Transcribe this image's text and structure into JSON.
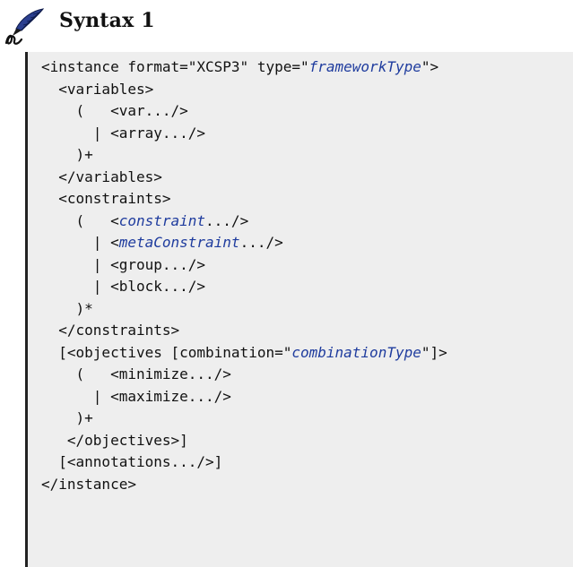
{
  "header": {
    "title": "Syntax 1"
  },
  "code": {
    "lines": [
      [
        {
          "t": "<instance format=\"XCSP3\" type=\""
        },
        {
          "t": "frameworkType",
          "s": "kw"
        },
        {
          "t": "\">"
        }
      ],
      [
        {
          "t": "  <variables>"
        }
      ],
      [
        {
          "t": "    (   <var.../>"
        }
      ],
      [
        {
          "t": "      | <array.../>"
        }
      ],
      [
        {
          "t": "    )+"
        }
      ],
      [
        {
          "t": "  </variables>"
        }
      ],
      [
        {
          "t": "  <constraints>"
        }
      ],
      [
        {
          "t": "    (   <"
        },
        {
          "t": "constraint",
          "s": "kw"
        },
        {
          "t": ".../>"
        }
      ],
      [
        {
          "t": "      | <"
        },
        {
          "t": "metaConstraint",
          "s": "kw"
        },
        {
          "t": ".../>"
        }
      ],
      [
        {
          "t": "      | <group.../>"
        }
      ],
      [
        {
          "t": "      | <block.../>"
        }
      ],
      [
        {
          "t": "    )*"
        }
      ],
      [
        {
          "t": "  </constraints>"
        }
      ],
      [
        {
          "t": "  [<objectives [combination=\""
        },
        {
          "t": "combinationType",
          "s": "kw"
        },
        {
          "t": "\"]>"
        }
      ],
      [
        {
          "t": "    (   <minimize.../>"
        }
      ],
      [
        {
          "t": "      | <maximize.../>"
        }
      ],
      [
        {
          "t": "    )+"
        }
      ],
      [
        {
          "t": "   </objectives>]"
        }
      ],
      [
        {
          "t": "  [<annotations.../>]"
        }
      ],
      [
        {
          "t": "</instance>"
        }
      ]
    ]
  },
  "colors": {
    "code_background": "#eeeeee",
    "keyword": "#1f3c9e",
    "text": "#111111"
  },
  "icons": {
    "header_icon": "quill-pen-icon"
  }
}
